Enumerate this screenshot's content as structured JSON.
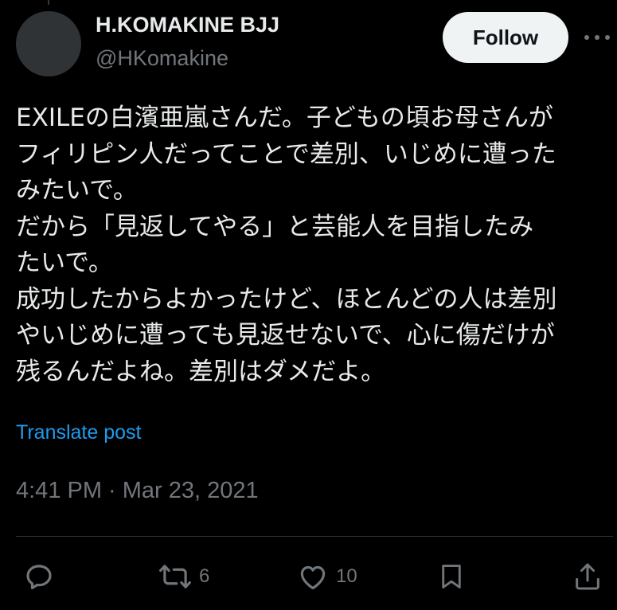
{
  "author": {
    "display_name": "H.KOMAKINE BJJ",
    "handle": "@HKomakine"
  },
  "header": {
    "follow_label": "Follow",
    "more_icon": "more-dots-icon"
  },
  "post": {
    "lines": [
      "EXILEの白濱亜嵐さんだ。子どもの頃お母さんが",
      "フィリピン人だってことで差別、いじめに遭った",
      "みたいで。",
      "だから「見返してやる」と芸能人を目指したみ",
      "たいで。",
      "成功したからよかったけど、ほとんどの人は差別",
      "やいじめに遭っても見返せないで、心に傷だけが",
      "残るんだよね。差別はダメだよ。"
    ],
    "translate_label": "Translate post",
    "timestamp": "4:41 PM · Mar 23, 2021"
  },
  "actions": {
    "reply": {
      "icon": "reply-icon",
      "count": ""
    },
    "repost": {
      "icon": "repost-icon",
      "count": "6"
    },
    "like": {
      "icon": "heart-icon",
      "count": "10"
    },
    "bookmark": {
      "icon": "bookmark-icon",
      "count": ""
    },
    "share": {
      "icon": "share-icon",
      "count": ""
    }
  },
  "colors": {
    "background": "#000000",
    "primary_text": "#e7e9ea",
    "secondary_text": "#71767b",
    "link": "#1d9bf0",
    "follow_button_bg": "#eff3f4",
    "divider": "#2f3336"
  }
}
